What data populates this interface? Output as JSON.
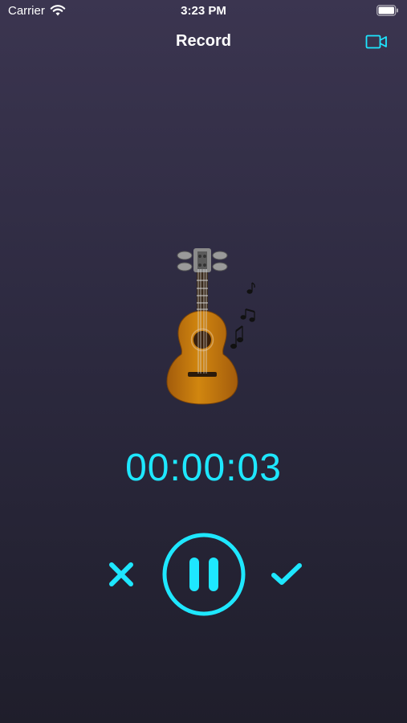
{
  "status_bar": {
    "carrier": "Carrier",
    "time": "3:23 PM"
  },
  "nav": {
    "title": "Record",
    "right_icon": "video-camera-icon"
  },
  "illustration": "guitar-with-music-notes",
  "recording": {
    "elapsed": "00:00:03"
  },
  "controls": {
    "cancel_icon": "close-icon",
    "pause_icon": "pause-icon",
    "confirm_icon": "checkmark-icon"
  },
  "colors": {
    "accent": "#1ee7ff",
    "background_top": "#3b3550",
    "background_bottom": "#1f1e2b"
  }
}
